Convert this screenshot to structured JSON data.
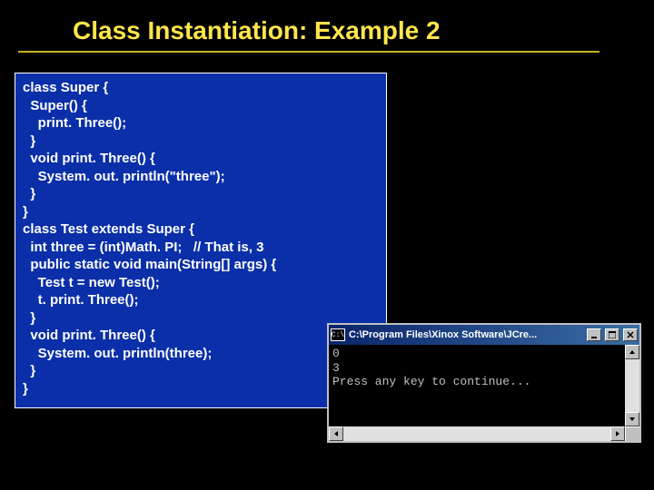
{
  "title": "Class Instantiation: Example 2",
  "code": "class Super {\n  Super() {\n    print. Three();\n  }\n  void print. Three() {\n    System. out. println(\"three\");\n  }\n}\nclass Test extends Super {\n  int three = (int)Math. PI;   // That is, 3\n  public static void main(String[] args) {\n    Test t = new Test();\n    t. print. Three();\n  }\n  void print. Three() {\n    System. out. println(three);\n  }\n}",
  "console": {
    "icon_label": "C:\\",
    "title": "C:\\Program Files\\Xinox Software\\JCre...",
    "output": "0\n3\nPress any key to continue..."
  }
}
